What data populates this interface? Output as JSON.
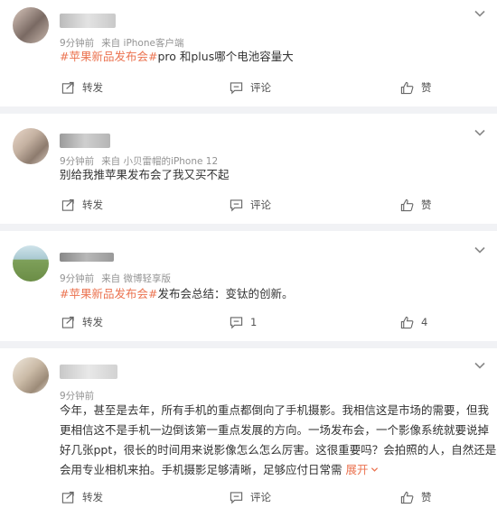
{
  "actions": {
    "repost": "转发",
    "comment": "评论",
    "like": "赞"
  },
  "posts": [
    {
      "meta_time": "9分钟前",
      "meta_source": "来自 iPhone客户端",
      "hashtag": "#苹果新品发布会#",
      "text": "pro 和plus哪个电池容量大",
      "comment_count": "",
      "like_count": ""
    },
    {
      "meta_time": "9分钟前",
      "meta_source": "来自 小贝雷帽的iPhone 12",
      "text": "别给我推苹果发布会了我又买不起",
      "comment_count": "",
      "like_count": ""
    },
    {
      "meta_time": "9分钟前",
      "meta_source": "来自 微博轻享版",
      "hashtag": "#苹果新品发布会#",
      "text": "发布会总结：变钛的创新。",
      "comment_count": "1",
      "like_count": "4"
    },
    {
      "meta_time": "9分钟前",
      "lines": [
        "今年，甚至是去年，所有手机的重点都倒向了手机摄影。我相信这是市场的需要，但我",
        "更相信这不是手机一边倒该第一重点发展的方向。一场发布会，一个影像系统就要说掉",
        "好几张ppt，很长的时间用来说影像怎么怎么厉害。这很重要吗？会拍照的人，自然还是",
        "会用专业相机来拍。手机摄影足够清晰，足够应付日常需"
      ],
      "expand": "展开",
      "comment_count": "",
      "like_count": ""
    }
  ]
}
